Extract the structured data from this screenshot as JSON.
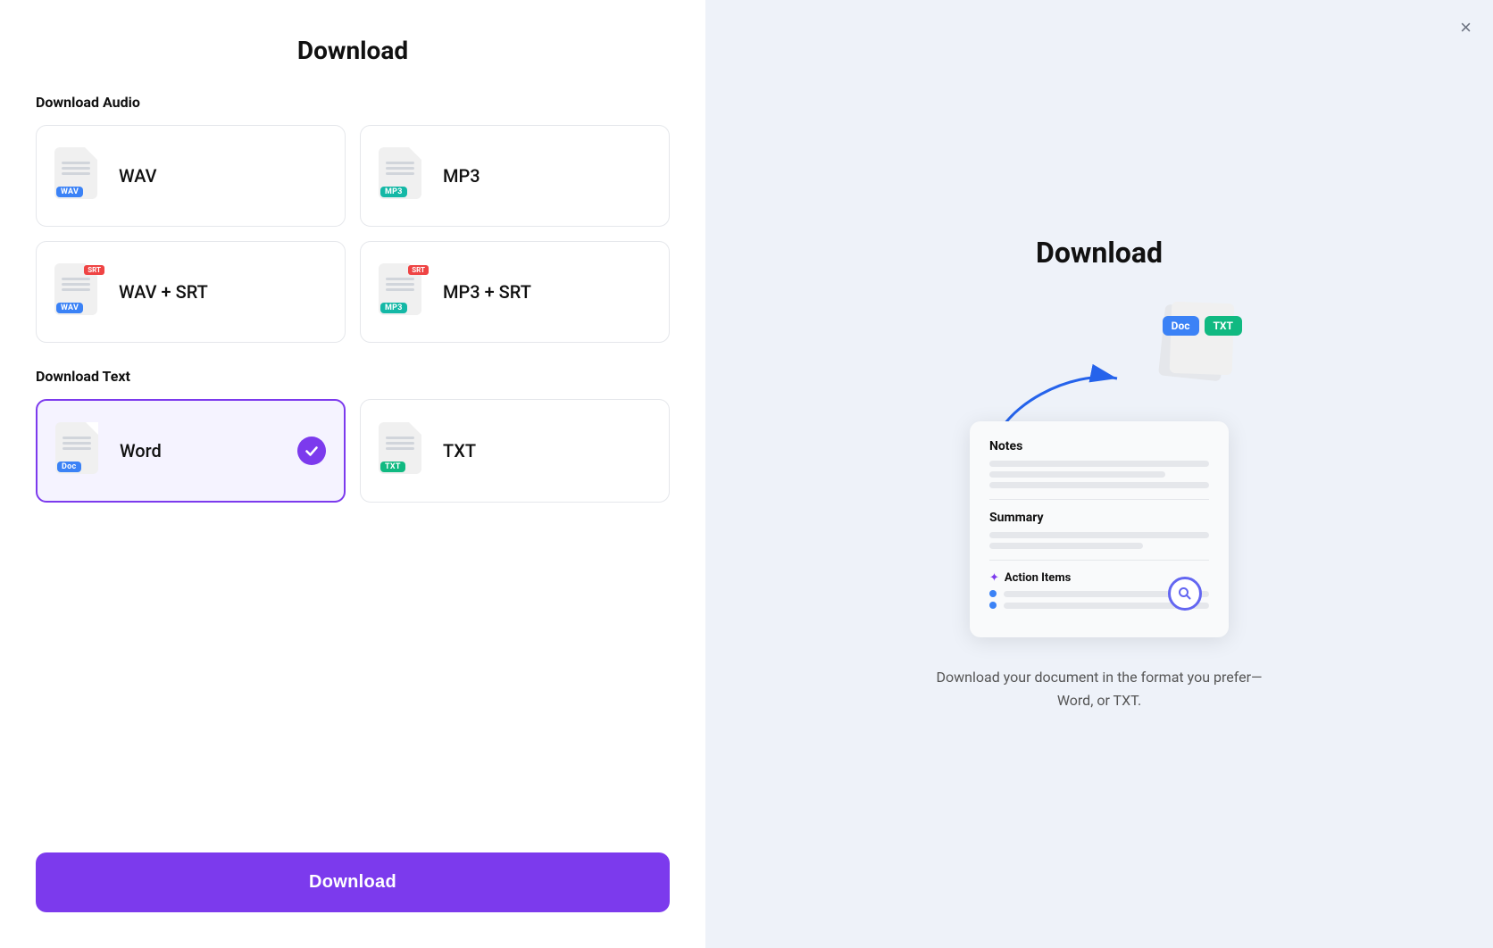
{
  "left": {
    "title": "Download",
    "sections": {
      "audio": {
        "label": "Download Audio",
        "formats": [
          {
            "id": "wav",
            "name": "WAV",
            "badge": "WAV",
            "badgeClass": "badge-wav",
            "hasSrt": false
          },
          {
            "id": "mp3",
            "name": "MP3",
            "badge": "MP3",
            "badgeClass": "badge-mp3",
            "hasSrt": false
          },
          {
            "id": "wav-srt",
            "name": "WAV + SRT",
            "badge": "WAV",
            "badgeClass": "badge-wav",
            "hasSrt": true
          },
          {
            "id": "mp3-srt",
            "name": "MP3 + SRT",
            "badge": "MP3",
            "badgeClass": "badge-mp3",
            "hasSrt": true
          }
        ]
      },
      "text": {
        "label": "Download Text",
        "formats": [
          {
            "id": "word",
            "name": "Word",
            "badge": "Doc",
            "badgeClass": "badge-doc",
            "hasSrt": false,
            "selected": true
          },
          {
            "id": "txt",
            "name": "TXT",
            "badge": "TXT",
            "badgeClass": "badge-txt",
            "hasSrt": false,
            "selected": false
          }
        ]
      }
    },
    "downloadButton": "Download"
  },
  "right": {
    "closeLabel": "×",
    "title": "Download",
    "floatingBadges": [
      "Doc",
      "TXT"
    ],
    "docPreview": {
      "notesLabel": "Notes",
      "summaryLabel": "Summary",
      "actionItemsLabel": "Action Items",
      "sparkle": "✦"
    },
    "description": "Download your document in the format you prefer—Word, or TXT."
  }
}
